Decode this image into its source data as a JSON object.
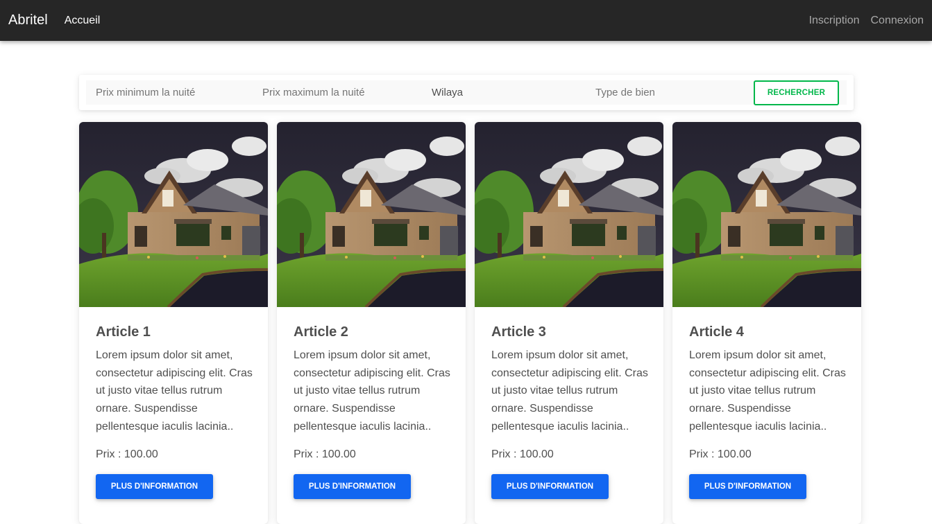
{
  "navbar": {
    "brand": "Abritel",
    "home": "Accueil",
    "register": "Inscription",
    "login": "Connexion"
  },
  "search": {
    "min_price_placeholder": "Prix minimum la nuité",
    "max_price_placeholder": "Prix maximum la nuité",
    "wilaya_value": "Wilaya",
    "property_type_placeholder": "Type de bien",
    "button_label": "RECHERCHER"
  },
  "cards": [
    {
      "title": "Article 1",
      "text": "Lorem ipsum dolor sit amet, consectetur adipiscing elit. Cras ut justo vitae tellus rutrum ornare. Suspendisse pellentesque iaculis lacinia..",
      "price": "Prix : 100.00",
      "button": "PLUS D'INFORMATION"
    },
    {
      "title": "Article 2",
      "text": "Lorem ipsum dolor sit amet, consectetur adipiscing elit. Cras ut justo vitae tellus rutrum ornare. Suspendisse pellentesque iaculis lacinia..",
      "price": "Prix : 100.00",
      "button": "PLUS D'INFORMATION"
    },
    {
      "title": "Article 3",
      "text": "Lorem ipsum dolor sit amet, consectetur adipiscing elit. Cras ut justo vitae tellus rutrum ornare. Suspendisse pellentesque iaculis lacinia..",
      "price": "Prix : 100.00",
      "button": "PLUS D'INFORMATION"
    },
    {
      "title": "Article 4",
      "text": "Lorem ipsum dolor sit amet, consectetur adipiscing elit. Cras ut justo vitae tellus rutrum ornare. Suspendisse pellentesque iaculis lacinia..",
      "price": "Prix : 100.00",
      "button": "PLUS D'INFORMATION"
    }
  ],
  "colors": {
    "navbar_bg": "#262626",
    "primary": "#1266f1",
    "success": "#00b74a"
  },
  "icons": {
    "card_image": "house-photo"
  }
}
